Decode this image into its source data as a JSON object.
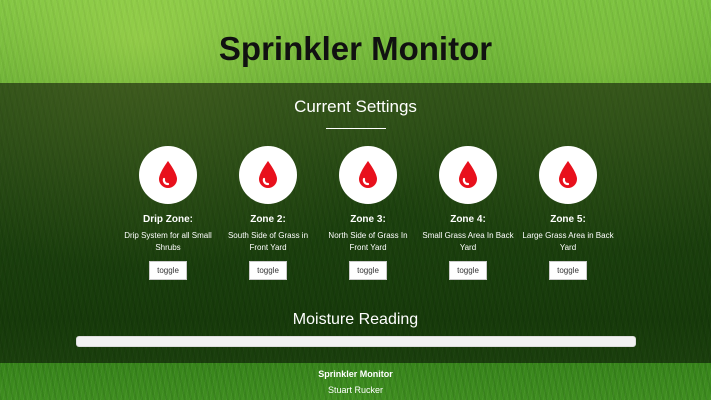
{
  "header": {
    "title": "Sprinkler Monitor"
  },
  "settings": {
    "title": "Current Settings",
    "icon": "water-drop-icon",
    "icon_color": "#e8101c",
    "zones": [
      {
        "name": "Drip Zone:",
        "description": "Drip System for all Small Shrubs",
        "button": "toggle"
      },
      {
        "name": "Zone 2:",
        "description": "South Side of Grass in Front Yard",
        "button": "toggle"
      },
      {
        "name": "Zone 3:",
        "description": "North Side of Grass In Front Yard",
        "button": "toggle"
      },
      {
        "name": "Zone 4:",
        "description": "Small Grass Area In Back Yard",
        "button": "toggle"
      },
      {
        "name": "Zone 5:",
        "description": "Large Grass Area in Back Yard",
        "button": "toggle"
      }
    ]
  },
  "moisture": {
    "title": "Moisture Reading",
    "level_percent": 0
  },
  "footer": {
    "title": "Sprinkler Monitor",
    "author": "Stuart Rucker"
  }
}
